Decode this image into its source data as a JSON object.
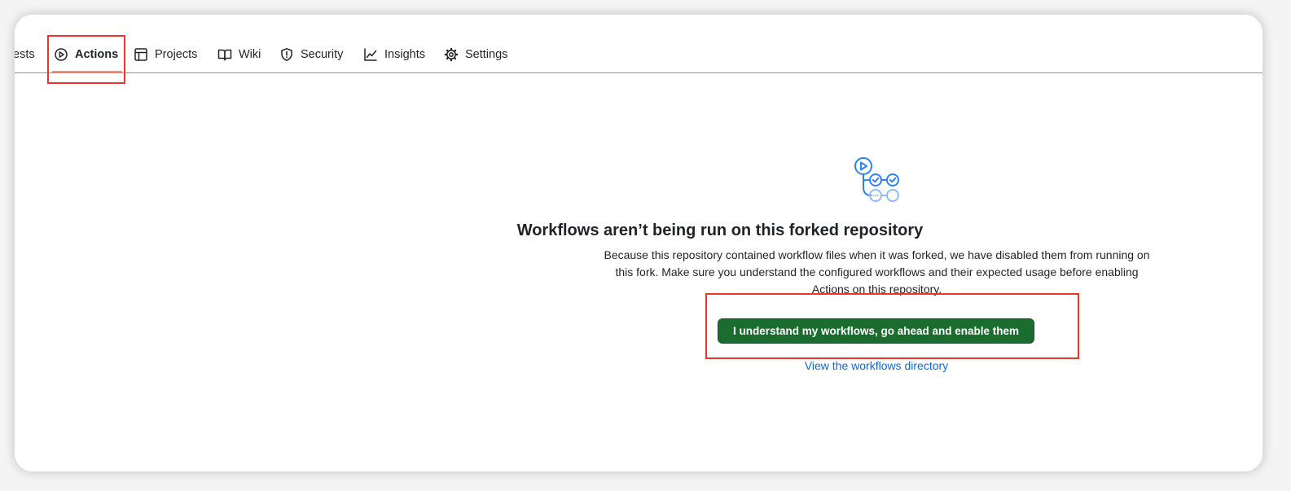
{
  "tabs": [
    {
      "label": "ests",
      "icon": "none"
    },
    {
      "label": "Actions",
      "icon": "play-icon",
      "selected": true
    },
    {
      "label": "Projects",
      "icon": "table-icon"
    },
    {
      "label": "Wiki",
      "icon": "book-icon"
    },
    {
      "label": "Security",
      "icon": "shield-icon"
    },
    {
      "label": "Insights",
      "icon": "graph-icon"
    },
    {
      "label": "Settings",
      "icon": "gear-icon"
    }
  ],
  "main": {
    "heading": "Workflows aren’t being run on this forked repository",
    "description": "Because this repository contained workflow files when it was forked, we have disabled them from running on this fork. Make sure you understand the configured workflows and their expected usage before enabling Actions on this repository.",
    "enable_button": "I understand my workflows, go ahead and enable them",
    "directory_link": "View the workflows directory"
  },
  "colors": {
    "accent_green": "#1a6d2e",
    "link_blue": "#0969da",
    "annotation_red": "#e8362a",
    "tab_underline": "#fd8c73"
  }
}
